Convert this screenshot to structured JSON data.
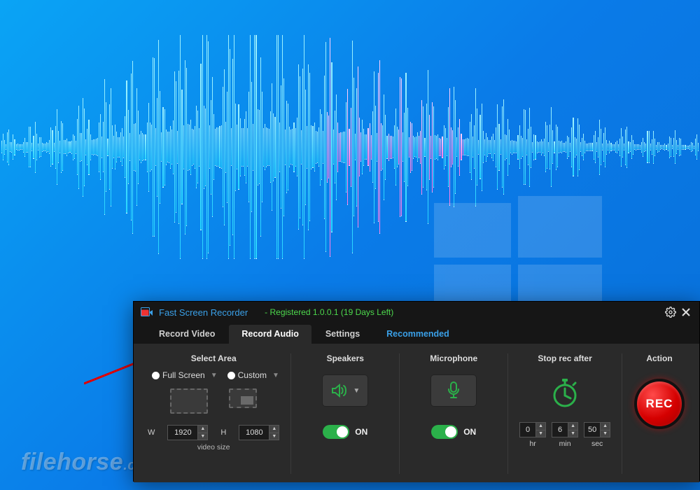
{
  "watermark": {
    "name": "filehorse",
    "tld": ".com"
  },
  "window": {
    "title": "Fast Screen Recorder",
    "status": "- Registered 1.0.0.1 (19 Days Left)"
  },
  "tabs": {
    "video": "Record Video",
    "audio": "Record Audio",
    "settings": "Settings",
    "recommended": "Recommended"
  },
  "sections": {
    "select_area": {
      "heading": "Select Area",
      "full_screen": "Full Screen",
      "custom": "Custom",
      "w_label": "W",
      "h_label": "H",
      "width": "1920",
      "height": "1080",
      "video_size": "video size"
    },
    "speakers": {
      "heading": "Speakers",
      "toggle": "ON"
    },
    "microphone": {
      "heading": "Microphone",
      "toggle": "ON"
    },
    "stop": {
      "heading": "Stop rec after",
      "hr": "0",
      "min": "6",
      "sec": "50",
      "hr_label": "hr",
      "min_label": "min",
      "sec_label": "sec"
    },
    "action": {
      "heading": "Action",
      "rec": "REC"
    }
  }
}
